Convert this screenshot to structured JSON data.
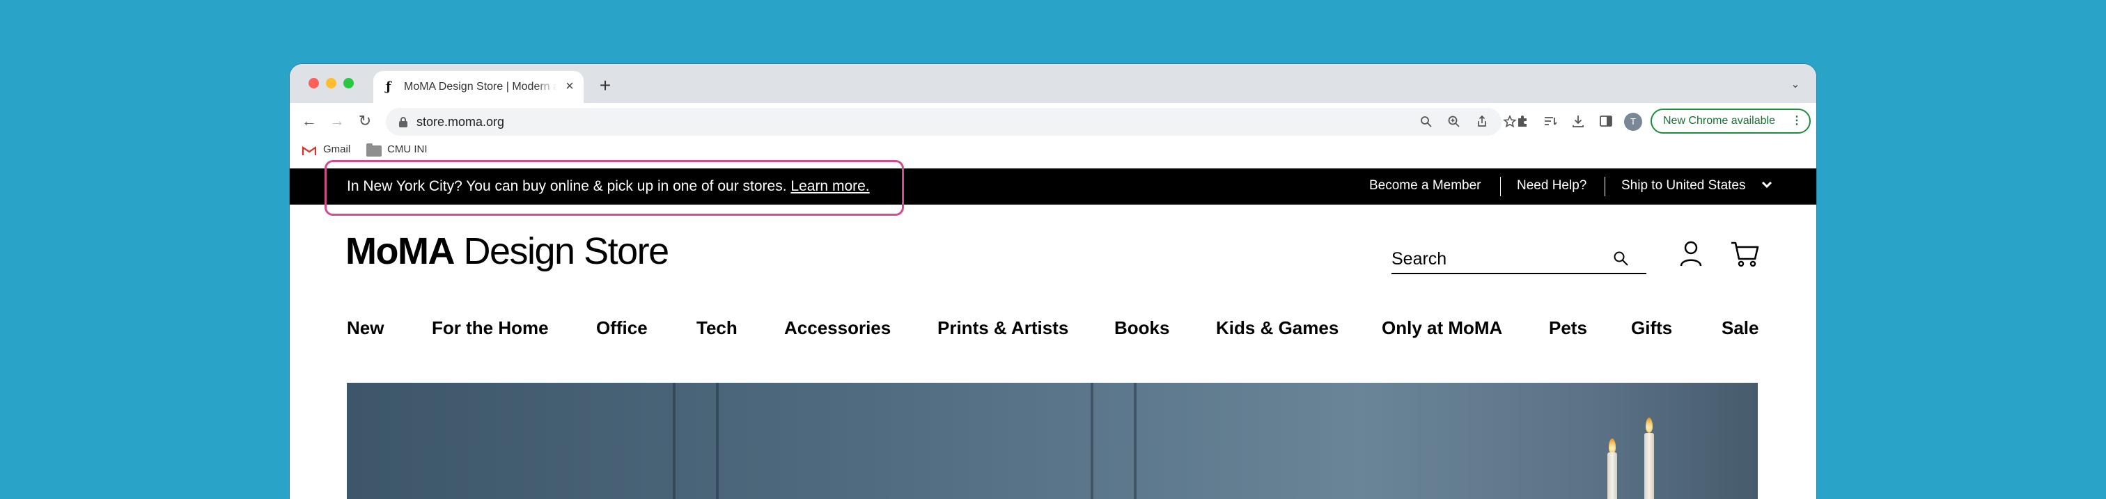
{
  "browser": {
    "tab": {
      "title": "MoMA Design Store | Modern and Contemporary Design",
      "close": "×"
    },
    "new_tab": "+",
    "tab_menu": "⌄",
    "nav": {
      "back": "←",
      "forward": "→",
      "reload": "↻"
    },
    "url": "store.moma.org",
    "omnibox_icons": [
      "search-icon",
      "zoom-icon",
      "share-icon",
      "star-icon"
    ],
    "toolbar_icons": [
      "extensions-icon",
      "reading-list-icon",
      "download-icon",
      "side-panel-icon"
    ],
    "profile_initial": "T",
    "update_button": "New Chrome available",
    "update_menu": "⋮",
    "bookmarks": [
      {
        "label": "Gmail",
        "icon": "gmail-icon"
      },
      {
        "label": "CMU INI",
        "icon": "folder-icon"
      }
    ]
  },
  "promo_bar": {
    "message": "In New York City? You can buy online & pick up in one of our stores.",
    "link": "Learn more.",
    "highlight_color": "#d14b8f",
    "links": [
      "Become a Member",
      "Need Help?",
      "Ship to United States"
    ]
  },
  "header": {
    "logo_bold": "MoMA",
    "logo_light": "Design Store",
    "search_label": "Search"
  },
  "nav": {
    "items": [
      "New",
      "For the Home",
      "Office",
      "Tech",
      "Accessories",
      "Prints & Artists",
      "Books",
      "Kids & Games",
      "Only at MoMA",
      "Pets",
      "Gifts",
      "Sale"
    ]
  },
  "colors": {
    "background": "#2aa3c9",
    "promo_bar": "#000000",
    "update_button": "#137333"
  }
}
